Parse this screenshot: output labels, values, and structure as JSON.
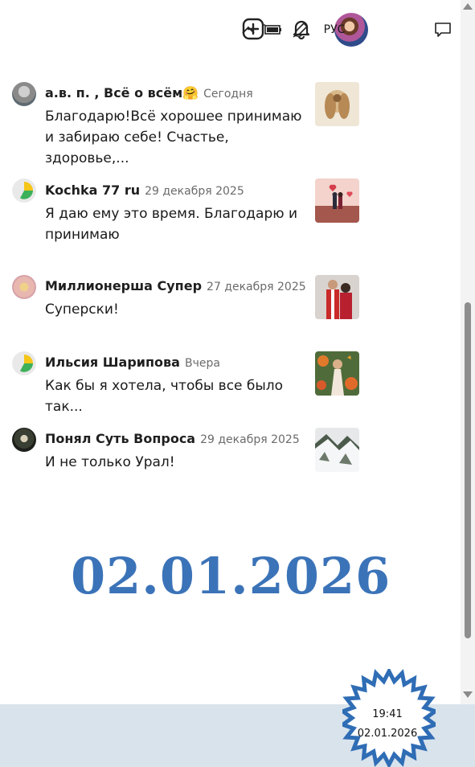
{
  "header": {
    "add_icon": "plus-square-icon",
    "bell_icon": "bell-icon",
    "avatar": "profile-avatar"
  },
  "feed": [
    {
      "author": "а.в. п. , Всё о всём",
      "emoji": "🤗",
      "date": "Сегодня",
      "text": "Благодарю!Всё хорошее принимаю и забираю себе! Счастье, здоровье,..."
    },
    {
      "author": "Kochka 77 ru",
      "date": "29 декабря 2025",
      "text": "Я даю ему это время. Благодарю и принимаю"
    },
    {
      "author": "Миллионерша Супер",
      "date": "27 декабря 2025",
      "text": "Суперски!"
    },
    {
      "author": "Ильсия Шарипова",
      "date": "Вчера",
      "text": "Как бы я хотела, чтобы все было так..."
    },
    {
      "author": "Понял Суть Вопроса",
      "date": "29 декабря 2025",
      "text": "И не только Урал!"
    }
  ],
  "overlay_date": "02.01.2026",
  "taskbar": {
    "language": "РУС",
    "time": "19:41",
    "date": "02.01.2026"
  },
  "colors": {
    "overlay_date": "#3b73b8",
    "taskbar_bg": "#d9e3ec",
    "star_stroke": "#2f6db5"
  }
}
